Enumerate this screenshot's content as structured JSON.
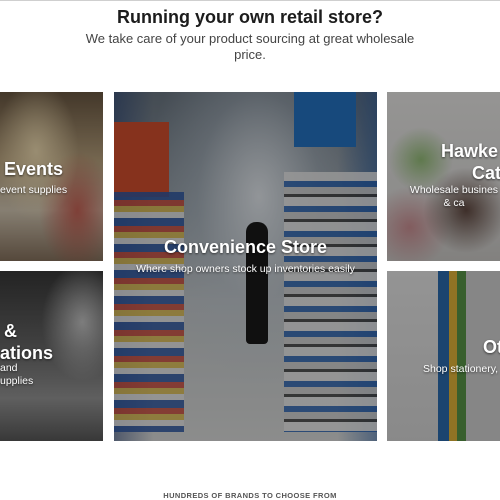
{
  "hero": {
    "title": "Running your own retail store?",
    "subtitle": "We take care of your product sourcing at great wholesale price."
  },
  "tiles": [
    {
      "id": "events",
      "title": "Events",
      "description": "event supplies"
    },
    {
      "id": "convenience-store",
      "title": "Convenience Store",
      "description": "Where shop owners stock up inventories easily"
    },
    {
      "id": "hawker",
      "title_line1": "Hawke",
      "title_line2": "Cat",
      "description_line1": "Wholesale busines",
      "description_line2": "& ca"
    },
    {
      "id": "conferences",
      "title_line1": "&",
      "title_line2": "ations",
      "description_line1": "and",
      "description_line2": "upplies"
    },
    {
      "id": "office",
      "title": "Ot",
      "description": "Shop stationery,"
    }
  ],
  "footer": {
    "brands_heading": "HUNDREDS OF BRANDS TO CHOOSE FROM"
  },
  "colors": {
    "overlay": "rgba(0,0,0,0.38)",
    "tile_text": "#ffffff",
    "heading_text": "#1c1c1c"
  }
}
